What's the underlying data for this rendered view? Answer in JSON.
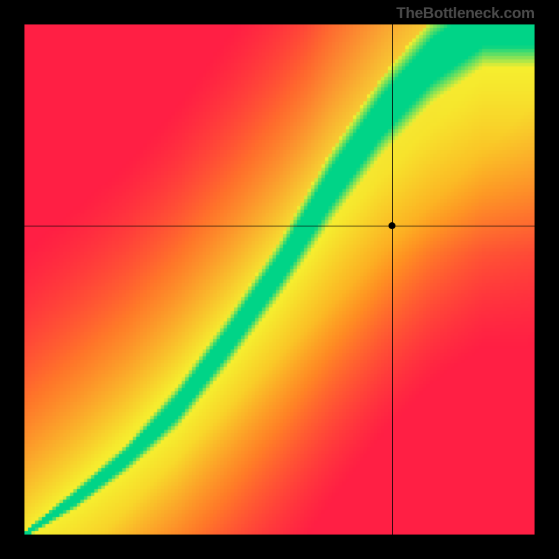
{
  "watermark": "TheBottleneck.com",
  "chart_data": {
    "type": "heatmap",
    "title": "",
    "xlabel": "",
    "ylabel": "",
    "xlim": [
      0,
      1
    ],
    "ylim": [
      0,
      1
    ],
    "crosshair": {
      "x": 0.72,
      "y": 0.605
    },
    "marker": {
      "x": 0.72,
      "y": 0.605
    },
    "optimal_band": {
      "description": "green diagonal band representing balanced pairing",
      "points_center": [
        [
          0.0,
          0.0
        ],
        [
          0.1,
          0.07
        ],
        [
          0.2,
          0.15
        ],
        [
          0.3,
          0.25
        ],
        [
          0.4,
          0.38
        ],
        [
          0.5,
          0.52
        ],
        [
          0.6,
          0.68
        ],
        [
          0.7,
          0.82
        ],
        [
          0.8,
          0.93
        ],
        [
          0.9,
          1.0
        ]
      ],
      "width_fraction": [
        [
          0.0,
          0.005
        ],
        [
          0.1,
          0.015
        ],
        [
          0.2,
          0.02
        ],
        [
          0.3,
          0.03
        ],
        [
          0.4,
          0.035
        ],
        [
          0.5,
          0.04
        ],
        [
          0.6,
          0.05
        ],
        [
          0.7,
          0.055
        ],
        [
          0.8,
          0.06
        ],
        [
          0.9,
          0.06
        ],
        [
          1.0,
          0.06
        ]
      ]
    },
    "color_stops": {
      "optimal": "#00d487",
      "near": "#f6ef2f",
      "mid": "#ff9a1f",
      "far": "#ff1f44"
    },
    "grid": false,
    "legend": false
  }
}
